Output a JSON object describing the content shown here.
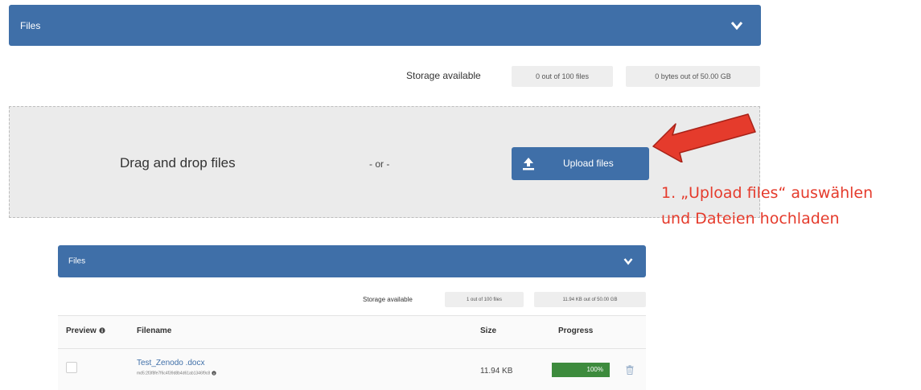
{
  "top_panel": {
    "title": "Files",
    "storage_label": "Storage available",
    "files_count": "0 out of 100 files",
    "bytes_used": "0 bytes out of 50.00 GB"
  },
  "dropzone": {
    "drag_text": "Drag and drop files",
    "or_text": "- or -",
    "upload_label": "Upload files"
  },
  "annotation": {
    "line1": "1. „Upload files“ auswählen",
    "line2": "und Dateien hochladen",
    "color": "#e53b2c"
  },
  "bottom_panel": {
    "title": "Files",
    "storage_label": "Storage available",
    "files_count": "1 out of 100 files",
    "bytes_used": "11.94 KB out of 50.00 GB",
    "columns": {
      "preview": "Preview",
      "filename": "Filename",
      "size": "Size",
      "progress": "Progress"
    },
    "rows": [
      {
        "filename": "Test_Zenodo .docx",
        "checksum": "md5:2f3f8fe7f6c4f39d8b4d61ab1346f9c8",
        "size": "11.94 KB",
        "progress_text": "100%",
        "progress_fraction": 1.0
      }
    ]
  },
  "colors": {
    "header_blue": "#3f6fa8",
    "progress_green": "#3d8b3d"
  },
  "icons": [
    "chevron-down-icon",
    "upload-icon",
    "info-icon",
    "trash-icon",
    "arrow-annotation"
  ]
}
